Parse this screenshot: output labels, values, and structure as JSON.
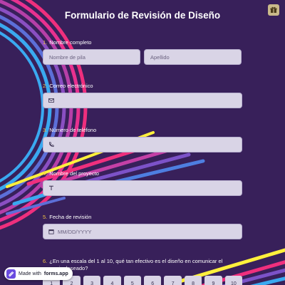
{
  "form": {
    "title": "Formulario de Revisión de Diseño",
    "corner_icon": "gift-icon"
  },
  "questions": [
    {
      "number": "1.",
      "label": "Nombre completo",
      "fields": [
        {
          "placeholder": "Nombre de pila"
        },
        {
          "placeholder": "Apellido"
        }
      ]
    },
    {
      "number": "2.",
      "label": "Correo electrónico",
      "icon": "envelope-icon",
      "placeholder": ""
    },
    {
      "number": "3.",
      "label": "Número de teléfono",
      "icon": "phone-icon",
      "placeholder": ""
    },
    {
      "number": "4.",
      "label": "Nombre del proyecto",
      "icon": "text-icon",
      "placeholder": ""
    },
    {
      "number": "5.",
      "label": "Fecha de revisión",
      "icon": "calendar-icon",
      "placeholder": "MM/DD/YYYY"
    },
    {
      "number": "6.",
      "label": "¿En una escala del 1 al 10, qué tan efectivo es el diseño en comunicar el mensaje deseado?",
      "scale": [
        "1",
        "2",
        "3",
        "4",
        "5",
        "6",
        "7",
        "8",
        "9",
        "10"
      ]
    }
  ],
  "badge": {
    "prefix": "Made with",
    "brand": "forms.app",
    "icon": "forms-app-logo-icon"
  },
  "colors": {
    "background": "#38205a",
    "number_accent": "#f5c542",
    "field_bg": "#d9d4e6",
    "stripe_pink": "#ef2f7d",
    "stripe_blue": "#3aa9f0",
    "stripe_yellow": "#fff03c"
  }
}
